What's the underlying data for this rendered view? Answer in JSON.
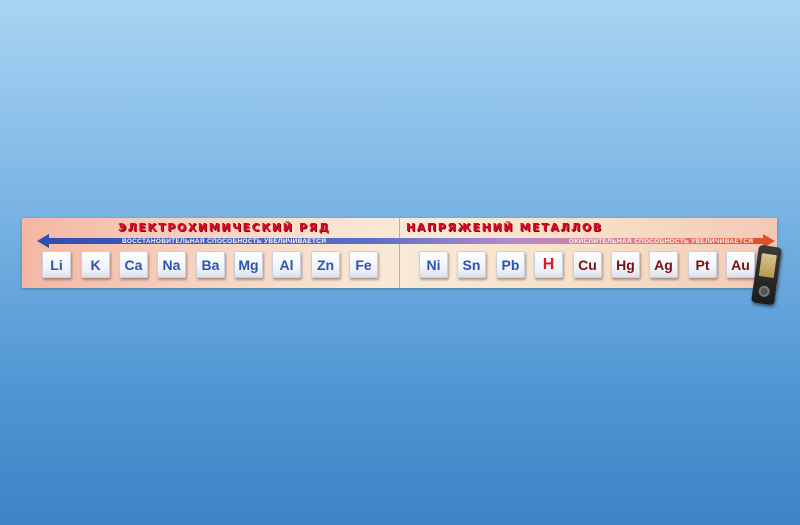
{
  "banner": {
    "title_left": "ЭЛЕКТРОХИМИЧЕСКИЙ РЯД",
    "title_right": "НАПРЯЖЕНИЙ МЕТАЛЛОВ",
    "caption_left": "ВОССТАНОВИТЕЛЬНАЯ СПОСОБНОСТЬ УВЕЛИЧИВАЕТСЯ",
    "caption_right": "ОКИСЛИТЕЛЬНАЯ СПОСОБНОСТЬ УВЕЛИЧИВАЕТСЯ"
  },
  "elements": [
    "Li",
    "K",
    "Ca",
    "Na",
    "Ba",
    "Mg",
    "Al",
    "Zn",
    "Fe",
    "Ni",
    "Sn",
    "Pb",
    "H",
    "Cu",
    "Hg",
    "Ag",
    "Pt",
    "Au"
  ],
  "colors": {
    "metal_active": "#2b53b5",
    "hydrogen": "#e0142a",
    "metal_noble": "#7a1010",
    "title": "#d80d24"
  },
  "icons": {
    "arrow": "double-headed-arrow-icon",
    "device": "handheld-device-icon"
  }
}
